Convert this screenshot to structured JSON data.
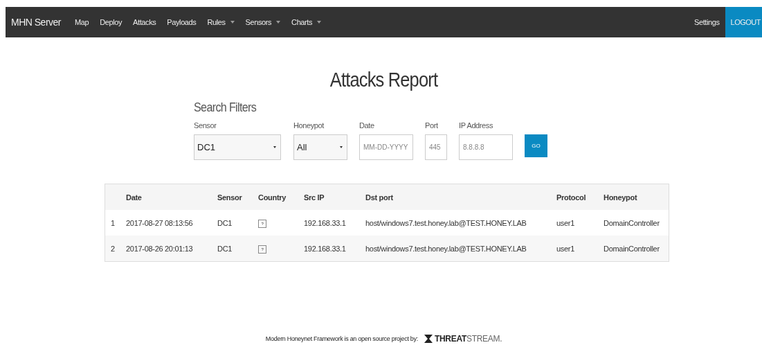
{
  "navbar": {
    "brand": "MHN Server",
    "items": [
      {
        "label": "Map",
        "dropdown": false
      },
      {
        "label": "Deploy",
        "dropdown": false
      },
      {
        "label": "Attacks",
        "dropdown": false
      },
      {
        "label": "Payloads",
        "dropdown": false
      },
      {
        "label": "Rules",
        "dropdown": true
      },
      {
        "label": "Sensors",
        "dropdown": true
      },
      {
        "label": "Charts",
        "dropdown": true
      }
    ],
    "settings": "Settings",
    "logout": "LOGOUT"
  },
  "title": "Attacks Report",
  "filters": {
    "heading": "Search Filters",
    "fields": [
      {
        "kind": "select",
        "label": "Sensor",
        "value": "DC1"
      },
      {
        "kind": "select",
        "label": "Honeypot",
        "value": "All"
      },
      {
        "kind": "input",
        "label": "Date",
        "placeholder": "MM-DD-YYYY"
      },
      {
        "kind": "input",
        "label": "Port",
        "placeholder": "445"
      },
      {
        "kind": "input",
        "label": "IP Address",
        "placeholder": "8.8.8.8"
      }
    ],
    "button": "GO"
  },
  "table": {
    "columns": [
      "Date",
      "Sensor",
      "Country",
      "Src IP",
      "Dst port",
      "Protocol",
      "Honeypot"
    ],
    "rows": [
      {
        "index": "1",
        "cells": [
          "2017-08-27 08:13:56",
          "DC1",
          "?",
          "192.168.33.1",
          "host/windows7.test.honey.lab@TEST.HONEY.LAB",
          "user1",
          "DomainController"
        ]
      },
      {
        "index": "2",
        "cells": [
          "2017-08-26 20:01:13",
          "DC1",
          "?",
          "192.168.33.1",
          "host/windows7.test.honey.lab@TEST.HONEY.LAB",
          "user1",
          "DomainController"
        ]
      }
    ]
  },
  "footer": {
    "text": "Modern Honeynet Framework is an open source project by:",
    "logo_bold": "THREAT",
    "logo_light": "STREAM."
  }
}
